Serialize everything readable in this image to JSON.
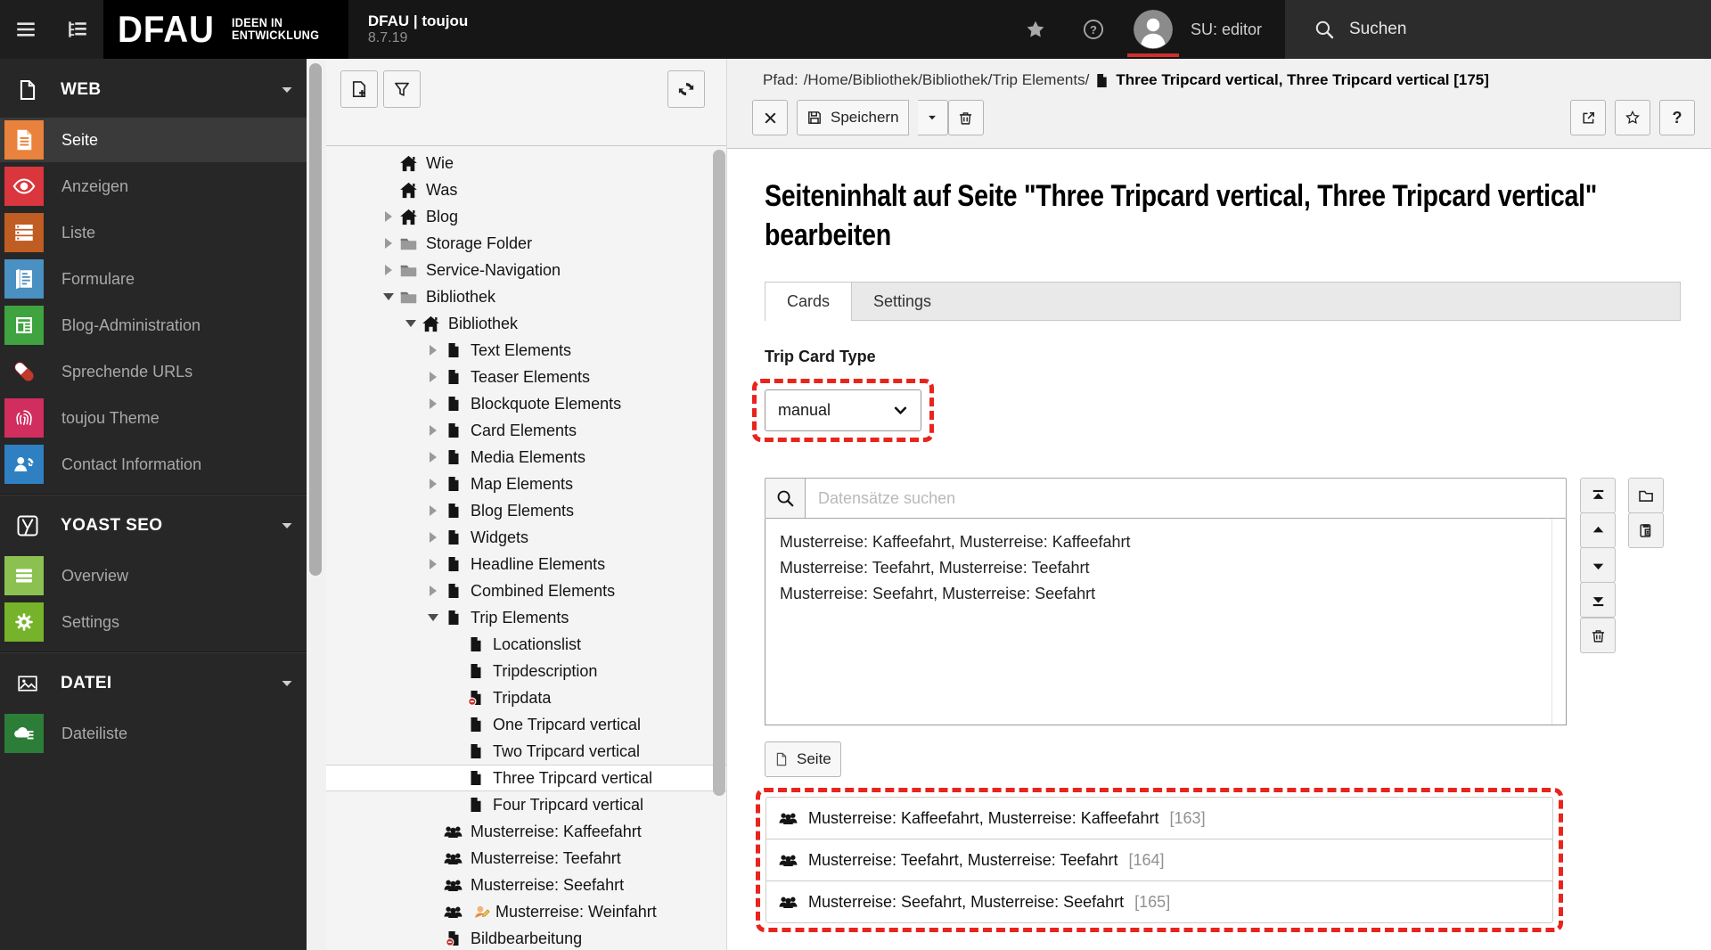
{
  "annotations": {
    "color": "#e8241c"
  },
  "topbar": {
    "brand": "DFAU",
    "brand_tag_line1": "IDEEN IN",
    "brand_tag_line2": "ENTWICKLUNG",
    "app_name": "DFAU | toujou",
    "app_version": "8.7.19",
    "user": "SU: editor",
    "search_label": "Suchen"
  },
  "sidebar": {
    "sections": [
      {
        "label": "WEB",
        "icon": "page-outline-white",
        "items": [
          {
            "label": "Seite",
            "icon": "doc-lines",
            "color": "#e8823c",
            "active": true
          },
          {
            "label": "Anzeigen",
            "icon": "eye",
            "color": "#d9363e",
            "active": false
          },
          {
            "label": "Liste",
            "icon": "list-bars",
            "color": "#bf5d22",
            "active": false
          },
          {
            "label": "Formulare",
            "icon": "form-page",
            "color": "#4a90c2",
            "active": false
          },
          {
            "label": "Blog-Administration",
            "icon": "blog-grid",
            "color": "#3fa33f",
            "active": false
          },
          {
            "label": "Sprechende URLs",
            "icon": "pill",
            "color": "",
            "active": false
          },
          {
            "label": "toujou Theme",
            "icon": "fingerprint",
            "color": "#d12d5f",
            "active": false
          },
          {
            "label": "Contact Information",
            "icon": "contact-person",
            "color": "#2e80c2",
            "active": false
          }
        ]
      },
      {
        "label": "YOAST SEO",
        "icon": "yoast-logo",
        "items": [
          {
            "label": "Overview",
            "icon": "menu-bars",
            "color": "#8cc152",
            "active": false
          },
          {
            "label": "Settings",
            "icon": "gear",
            "color": "#76b22a",
            "active": false
          }
        ]
      },
      {
        "label": "DATEI",
        "icon": "image-frame",
        "items": [
          {
            "label": "Dateiliste",
            "icon": "cloud-list",
            "color": "#2c7d37",
            "active": false
          }
        ]
      }
    ]
  },
  "tree": {
    "items": [
      {
        "label": "Wie",
        "icon": "home",
        "level": 0,
        "arrow": null
      },
      {
        "label": "Was",
        "icon": "home",
        "level": 0,
        "arrow": null
      },
      {
        "label": "Blog",
        "icon": "home",
        "level": 0,
        "arrow": "closed"
      },
      {
        "label": "Storage Folder",
        "icon": "folder",
        "level": 0,
        "arrow": "closed"
      },
      {
        "label": "Service-Navigation",
        "icon": "folder",
        "level": 0,
        "arrow": "closed"
      },
      {
        "label": "Bibliothek",
        "icon": "folder",
        "level": 0,
        "arrow": "open"
      },
      {
        "label": "Bibliothek",
        "icon": "home",
        "level": 1,
        "arrow": "open"
      },
      {
        "label": "Text Elements",
        "icon": "page",
        "level": 2,
        "arrow": "closed"
      },
      {
        "label": "Teaser Elements",
        "icon": "page",
        "level": 2,
        "arrow": "closed"
      },
      {
        "label": "Blockquote Elements",
        "icon": "page",
        "level": 2,
        "arrow": "closed"
      },
      {
        "label": "Card Elements",
        "icon": "page",
        "level": 2,
        "arrow": "closed"
      },
      {
        "label": "Media Elements",
        "icon": "page",
        "level": 2,
        "arrow": "closed"
      },
      {
        "label": "Map Elements",
        "icon": "page",
        "level": 2,
        "arrow": "closed"
      },
      {
        "label": "Blog Elements",
        "icon": "page",
        "level": 2,
        "arrow": "closed"
      },
      {
        "label": "Widgets",
        "icon": "page",
        "level": 2,
        "arrow": "closed"
      },
      {
        "label": "Headline Elements",
        "icon": "page",
        "level": 2,
        "arrow": "closed"
      },
      {
        "label": "Combined Elements",
        "icon": "page",
        "level": 2,
        "arrow": "closed"
      },
      {
        "label": "Trip Elements",
        "icon": "page",
        "level": 2,
        "arrow": "open"
      },
      {
        "label": "Locationslist",
        "icon": "page",
        "level": 3,
        "arrow": null
      },
      {
        "label": "Tripdescription",
        "icon": "page",
        "level": 3,
        "arrow": null
      },
      {
        "label": "Tripdata",
        "icon": "page-hidden",
        "level": 3,
        "arrow": null
      },
      {
        "label": "One Tripcard vertical",
        "icon": "page",
        "level": 3,
        "arrow": null
      },
      {
        "label": "Two Tripcard vertical",
        "icon": "page",
        "level": 3,
        "arrow": null
      },
      {
        "label": "Three Tripcard vertical",
        "icon": "page",
        "level": 3,
        "arrow": null,
        "selected": true
      },
      {
        "label": "Four Tripcard vertical",
        "icon": "page",
        "level": 3,
        "arrow": null
      },
      {
        "label": "Musterreise: Kaffeefahrt",
        "icon": "users",
        "level": 2,
        "arrow": null
      },
      {
        "label": "Musterreise: Teefahrt",
        "icon": "users",
        "level": 2,
        "arrow": null
      },
      {
        "label": "Musterreise: Seefahrt",
        "icon": "users",
        "level": 2,
        "arrow": null
      },
      {
        "label": "Musterreise: Weinfahrt",
        "icon": "users",
        "level": 2,
        "arrow": null,
        "editing": true
      },
      {
        "label": "Bildbearbeitung",
        "icon": "page-hidden",
        "level": 2,
        "arrow": null
      }
    ]
  },
  "docheader": {
    "path_label": "Pfad:",
    "path": "/Home/Bibliothek/Bibliothek/Trip Elements/",
    "doc_title": "Three Tripcard vertical, Three Tripcard vertical [175]",
    "save_label": "Speichern"
  },
  "main": {
    "heading": "Seiteninhalt auf Seite \"Three Tripcard vertical, Three Tripcard vertical\" bearbeiten",
    "tabs": [
      {
        "label": "Cards",
        "active": true
      },
      {
        "label": "Settings",
        "active": false
      }
    ],
    "field_label": "Trip Card Type",
    "select_value": "manual",
    "search_placeholder": "Datensätze suchen",
    "listbox_options": [
      "Musterreise: Kaffeefahrt, Musterreise: Kaffeefahrt",
      "Musterreise: Teefahrt, Musterreise: Teefahrt",
      "Musterreise: Seefahrt, Musterreise: Seefahrt"
    ],
    "move_buttons": [
      "move-to-top",
      "move-up",
      "move-down",
      "move-to-bottom",
      "delete"
    ],
    "util_buttons": [
      "browse-folder",
      "paste"
    ],
    "page_button_label": "Seite",
    "records": [
      {
        "label": "Musterreise: Kaffeefahrt, Musterreise: Kaffeefahrt",
        "id": "[163]"
      },
      {
        "label": "Musterreise: Teefahrt, Musterreise: Teefahrt",
        "id": "[164]"
      },
      {
        "label": "Musterreise: Seefahrt, Musterreise: Seefahrt",
        "id": "[165]"
      }
    ]
  }
}
